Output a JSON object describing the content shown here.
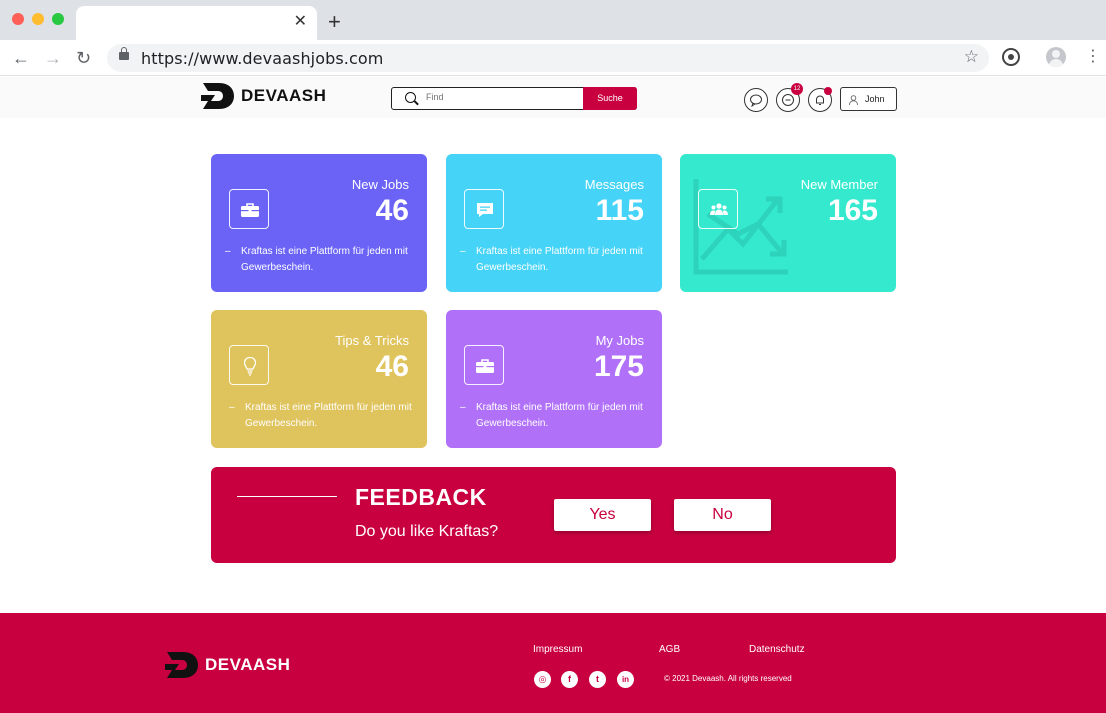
{
  "browser": {
    "url": "https://www.devaashjobs.com",
    "tab_close": "✕",
    "new_tab": "+"
  },
  "header": {
    "logo_text": "DEVAASH",
    "search_placeholder": "Find",
    "search_button": "Suche",
    "message_badge": "12",
    "user_label": "John"
  },
  "cards": [
    {
      "title": "New Jobs",
      "count": "46",
      "desc": "Kraftas ist eine Plattform für jeden mit Gewerbeschein.",
      "color": "#6a63f6",
      "icon": "briefcase-icon"
    },
    {
      "title": "Messages",
      "count": "115",
      "desc": "Kraftas ist eine Plattform für jeden mit Gewerbeschein.",
      "color": "#45d3f7",
      "icon": "chat-icon"
    },
    {
      "title": "New Member",
      "count": "165",
      "desc": "",
      "color": "#35e9cf",
      "icon": "users-icon"
    },
    {
      "title": "Tips & Tricks",
      "count": "46",
      "desc": "Kraftas ist eine Plattform für jeden mit Gewerbeschein.",
      "color": "#dfc35c",
      "icon": "lightbulb-icon"
    },
    {
      "title": "My Jobs",
      "count": "175",
      "desc": "Kraftas ist eine Plattform für jeden mit Gewerbeschein.",
      "color": "#b071f8",
      "icon": "briefcase-icon"
    }
  ],
  "feedback": {
    "title": "FEEDBACK",
    "question": "Do you like Kraftas?",
    "yes": "Yes",
    "no": "No"
  },
  "footer": {
    "logo_text": "DEVAASH",
    "links": [
      "Impressum",
      "AGB",
      "Datenschutz"
    ],
    "copyright": "© 2021 Devaash. All rights reserved"
  },
  "colors": {
    "brand": "#c9003f"
  }
}
